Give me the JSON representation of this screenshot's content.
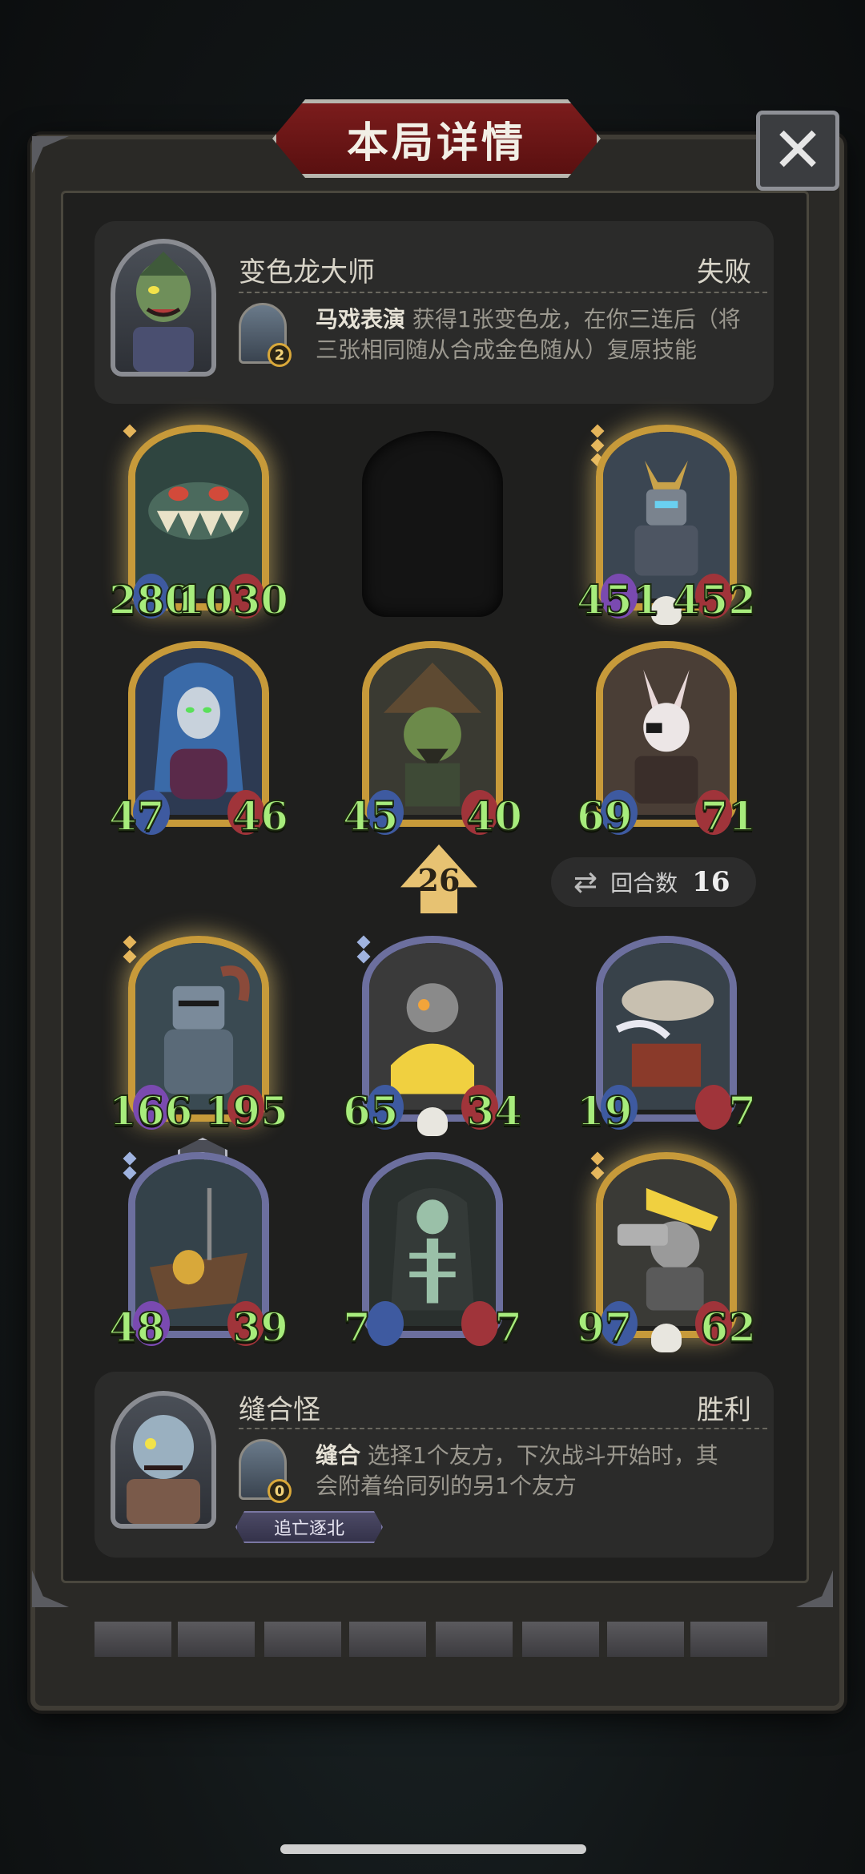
{
  "title": "本局详情",
  "close_label": "✕",
  "top_hero": {
    "name": "变色龙大师",
    "result": "失败",
    "skill_badge": "2",
    "skill_name": "马戏表演",
    "skill_desc_line1": "获得1张变色龙，在你三连后（将",
    "skill_desc_line2": "三张相同随从合成金色随从）复原技能"
  },
  "bottom_hero": {
    "name": "缝合怪",
    "result": "胜利",
    "skill_badge": "0",
    "skill_name": "缝合",
    "skill_desc_line1": "选择1个友方，下次战斗开始时，其",
    "skill_desc_line2": "会附着给同列的另1个友方",
    "tag": "追亡逐北"
  },
  "top_board": [
    {
      "atk": "280",
      "hp": "1030"
    },
    {
      "atk": "451",
      "hp": "452"
    },
    {
      "atk": "47",
      "hp": "46"
    },
    {
      "atk": "45",
      "hp": "40"
    },
    {
      "atk": "69",
      "hp": "71"
    }
  ],
  "bottom_board": [
    {
      "atk": "166",
      "hp": "195"
    },
    {
      "atk": "65",
      "hp": "34"
    },
    {
      "atk": "19",
      "hp": "7"
    },
    {
      "atk": "48",
      "hp": "39"
    },
    {
      "atk": "7",
      "hp": "7"
    },
    {
      "atk": "97",
      "hp": "62"
    }
  ],
  "level_badge": "2",
  "damage_value": "26",
  "round": {
    "label": "回合数",
    "value": "16"
  },
  "colors": {
    "gold_frame": "#c79a3a",
    "silver_frame": "#6c6f9e",
    "stat_green": "#a7ec7c",
    "banner_red": "#7b1c1c"
  }
}
